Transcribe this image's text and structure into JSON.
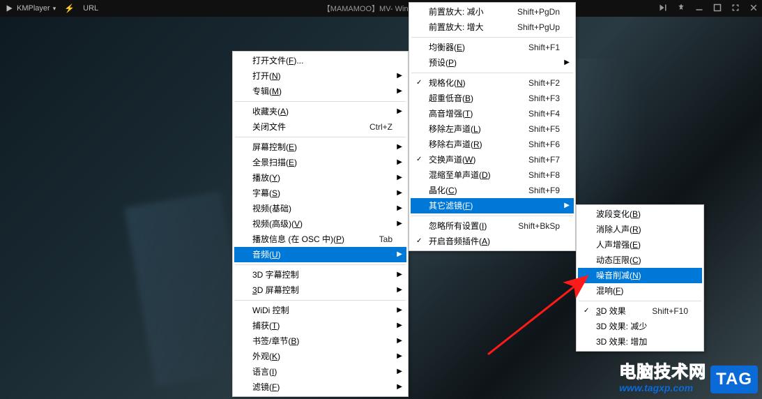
{
  "titlebar": {
    "app_name": "KMPlayer",
    "bolt_icon": "bolt-icon",
    "url_label": "URL",
    "title": "【MAMAMOO】MV- Wind Flower."
  },
  "menu1": {
    "items": [
      {
        "label": "打开文件(",
        "accel": "F",
        "tail": ")...",
        "arrow": false
      },
      {
        "label": "打开(",
        "accel": "N",
        "tail": ")",
        "arrow": true
      },
      {
        "label": "专辑(",
        "accel": "M",
        "tail": ")",
        "arrow": true
      },
      {
        "sep": true
      },
      {
        "label": "收藏夹(",
        "accel": "A",
        "tail": ")",
        "arrow": true
      },
      {
        "label": "关闭文件",
        "shortcut": "Ctrl+Z"
      },
      {
        "sep": true
      },
      {
        "label": "屏幕控制(",
        "accel": "E",
        "tail": ")",
        "arrow": true
      },
      {
        "label": "全景扫描(",
        "accel": "E",
        "tail": ")",
        "arrow": true
      },
      {
        "label": "播放(",
        "accel": "Y",
        "tail": ")",
        "arrow": true
      },
      {
        "label": "字幕(",
        "accel": "S",
        "tail": ")",
        "arrow": true
      },
      {
        "label": "视频(基础)",
        "arrow": true
      },
      {
        "label": "视频(高级)(",
        "accel": "V",
        "tail": ")",
        "arrow": true
      },
      {
        "label": "播放信息 (在 OSC 中)(",
        "accel": "P",
        "tail": ")",
        "shortcut": "Tab"
      },
      {
        "label": "音频(",
        "accel": "U",
        "tail": ")",
        "arrow": true,
        "highlighted": true
      },
      {
        "sep": true
      },
      {
        "label": "3D 字幕控制",
        "arrow": true
      },
      {
        "label_pre": "",
        "accel": "3",
        "tail": "D 屏幕控制",
        "arrow": true
      },
      {
        "sep": true
      },
      {
        "label": "WiDi 控制",
        "arrow": true
      },
      {
        "label": "捕获(",
        "accel": "T",
        "tail": ")",
        "arrow": true
      },
      {
        "label": "书签/章节(",
        "accel": "B",
        "tail": ")",
        "arrow": true
      },
      {
        "label": "外观(",
        "accel": "K",
        "tail": ")",
        "arrow": true
      },
      {
        "label": "语言(",
        "accel": "I",
        "tail": ")",
        "arrow": true
      },
      {
        "label": "滤镜(",
        "accel": "F",
        "tail": ")",
        "arrow": true
      }
    ]
  },
  "menu2": {
    "items": [
      {
        "label": "前置放大: 减小",
        "shortcut": "Shift+PgDn"
      },
      {
        "label": "前置放大: 增大",
        "shortcut": "Shift+PgUp"
      },
      {
        "sep": true
      },
      {
        "label": "均衡器(",
        "accel": "E",
        "tail": ")",
        "shortcut": "Shift+F1"
      },
      {
        "label": "预设(",
        "accel": "P",
        "tail": ")",
        "arrow": true
      },
      {
        "sep": true
      },
      {
        "label": "规格化(",
        "accel": "N",
        "tail": ")",
        "shortcut": "Shift+F2",
        "checked": true
      },
      {
        "label": "超重低音(",
        "accel": "B",
        "tail": ")",
        "shortcut": "Shift+F3"
      },
      {
        "label": "高音增强(",
        "accel": "T",
        "tail": ")",
        "shortcut": "Shift+F4"
      },
      {
        "label": "移除左声道(",
        "accel": "L",
        "tail": ")",
        "shortcut": "Shift+F5"
      },
      {
        "label": "移除右声道(",
        "accel": "R",
        "tail": ")",
        "shortcut": "Shift+F6"
      },
      {
        "label": "交换声道(",
        "accel": "W",
        "tail": ")",
        "shortcut": "Shift+F7",
        "checked": true
      },
      {
        "label": "混缩至单声道(",
        "accel": "D",
        "tail": ")",
        "shortcut": "Shift+F8"
      },
      {
        "label": "晶化(",
        "accel": "C",
        "tail": ")",
        "shortcut": "Shift+F9"
      },
      {
        "label": "其它滤镜(",
        "accel": "F",
        "tail": ")",
        "arrow": true,
        "highlighted": true
      },
      {
        "sep": true
      },
      {
        "label": "忽略所有设置(",
        "accel": "I",
        "tail": ")",
        "shortcut": "Shift+BkSp"
      },
      {
        "label": "开启音频插件(",
        "accel": "A",
        "tail": ")",
        "checked": true
      }
    ]
  },
  "menu3": {
    "items": [
      {
        "label": "波段变化(",
        "accel": "B",
        "tail": ")"
      },
      {
        "label": "消除人声(",
        "accel": "R",
        "tail": ")"
      },
      {
        "label": "人声增强(",
        "accel": "E",
        "tail": ")"
      },
      {
        "label": "动态压限(",
        "accel": "C",
        "tail": ")"
      },
      {
        "label": "噪音削减(",
        "accel": "N",
        "tail": ")",
        "highlighted": true
      },
      {
        "label": "混响(",
        "accel": "F",
        "tail": ")"
      },
      {
        "sep": true
      },
      {
        "label_pre": "",
        "accel": "3",
        "tail": "D 效果",
        "shortcut": "Shift+F10",
        "checked": true
      },
      {
        "label": "3D 效果: 减少"
      },
      {
        "label": "3D 效果: 增加"
      }
    ]
  },
  "watermark": {
    "cn": "电脑技术网",
    "url": "www.tagxp.com",
    "tag": "TAG"
  }
}
